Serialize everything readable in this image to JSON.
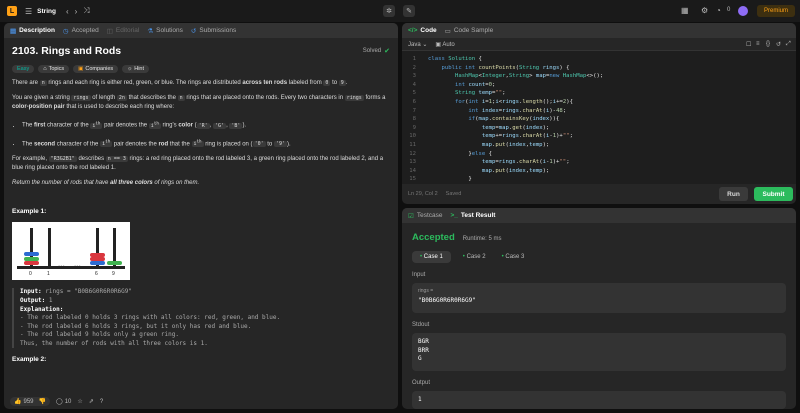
{
  "topbar": {
    "problem_list": "String",
    "premium": "Premium"
  },
  "left": {
    "tabs": [
      "Description",
      "Accepted",
      "Editorial",
      "Solutions",
      "Submissions"
    ],
    "title": "2103. Rings and Rods",
    "solved": "Solved",
    "tags": {
      "difficulty": "Easy",
      "topics": "Topics",
      "companies": "Companies",
      "hint": "Hint"
    },
    "p1": {
      "a": "There are ",
      "b": "n",
      "c": " rings and each ring is either red, green, or blue. The rings are distributed ",
      "d": "across ten rods",
      "e": " labeled from ",
      "f": "0",
      "g": " to ",
      "h": "9",
      "i": "."
    },
    "p2": {
      "a": "You are given a string ",
      "b": "rings",
      "c": " of length ",
      "d": "2n",
      "e": " that describes the ",
      "f": "n",
      "g": " rings that are placed onto the rods. Every two characters in ",
      "h": "rings",
      "i": " forms a ",
      "j": "color-position pair",
      "k": " that is used to describe each ring where:"
    },
    "b1": {
      "a": "The ",
      "b": "first",
      "c": " character of the ",
      "d": "i",
      "e": "th",
      "f": " pair denotes the ",
      "g": "i",
      "h": "th",
      "i": " ring's ",
      "j": "color",
      "k": " (",
      "l": "'R'",
      ",": ", ",
      "m": "'G'",
      "n": "'B'",
      "o": ")."
    },
    "b2": {
      "a": "The ",
      "b": "second",
      "c": " character of the ",
      "d": "i",
      "e": "th",
      "f": " pair denotes the ",
      "g": "rod",
      "h": " that the ",
      "i": "i",
      "j": "th",
      "k": " ring is placed on (",
      "l": "'0'",
      "m": " to ",
      "n": "'9'",
      "o": ")."
    },
    "p3": {
      "a": "For example, ",
      "b": "\"R3G2B1\"",
      "c": " describes ",
      "d": "n == 3",
      "e": " rings: a red ring placed onto the rod labeled 3, a green ring placed onto the rod labeled 2, and a blue ring placed onto the rod labeled 1."
    },
    "p4": {
      "a": "Return the number of rods that have ",
      "b": "all three colors",
      "c": " of rings on them."
    },
    "ex1": "Example 1:",
    "ex2": "Example 2:",
    "rod_labels": [
      "0",
      "1",
      "6",
      "9"
    ],
    "dots": "...",
    "input_label": "Input:",
    "input_val": "rings = \"B0B6G0R6R0R6G9\"",
    "output_label": "Output:",
    "output_val": "1",
    "expl_label": "Explanation:",
    "expl": [
      "- The rod labeled 0 holds 3 rings with all colors: red, green, and blue.",
      "- The rod labeled 6 holds 3 rings, but it only has red and blue.",
      "- The rod labeled 9 holds only a green ring.",
      "Thus, the number of rods with all three colors is 1."
    ],
    "likes": "959",
    "comments": "10"
  },
  "code": {
    "tabs": [
      "Code",
      "Code Sample"
    ],
    "lang": "Java",
    "auto": "Auto",
    "status": "Ln 29, Col 2",
    "saved": "Saved",
    "run": "Run",
    "submit": "Submit"
  },
  "result": {
    "tabs": [
      "Testcase",
      "Test Result"
    ],
    "accepted": "Accepted",
    "runtime": "Runtime: 5 ms",
    "cases": [
      "Case 1",
      "Case 2",
      "Case 3"
    ],
    "input": "Input",
    "rings_label": "rings =",
    "rings_val": "\"B0B6G0R6R0R6G9\"",
    "stdout": "Stdout",
    "stdout_lines": [
      "BGR",
      "BRR",
      "G"
    ],
    "output": "Output",
    "output_val": "1"
  }
}
